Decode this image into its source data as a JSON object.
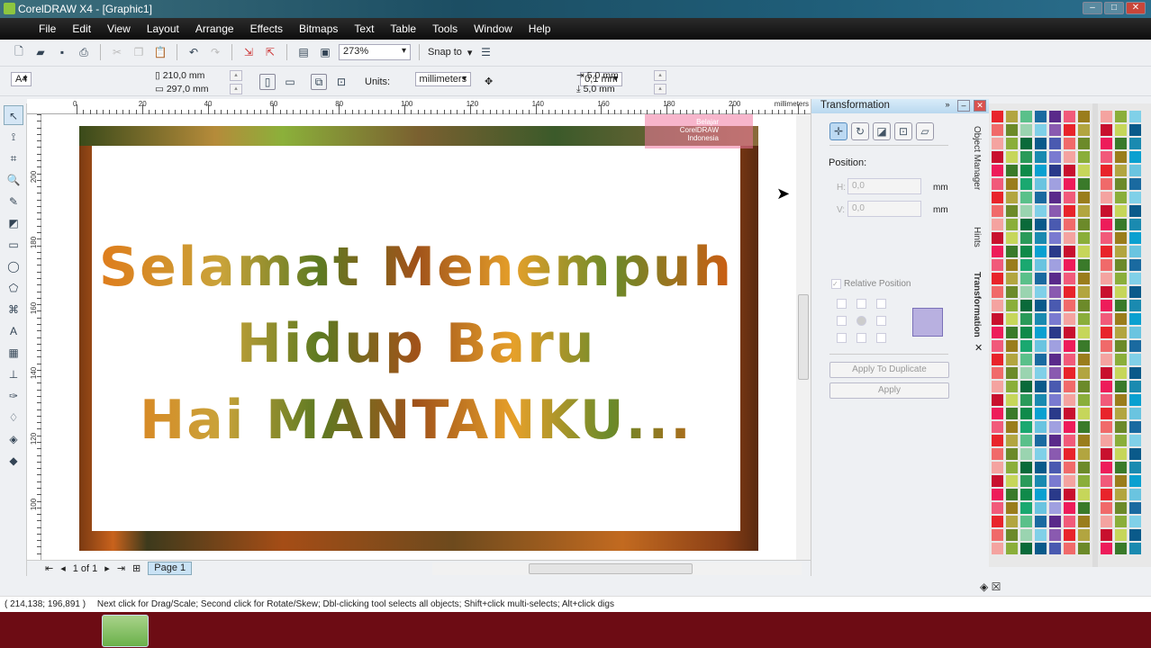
{
  "window": {
    "title": "CorelDRAW X4 - [Graphic1]",
    "app_icon": "coreldraw-icon"
  },
  "menu": [
    "File",
    "Edit",
    "View",
    "Layout",
    "Arrange",
    "Effects",
    "Bitmaps",
    "Text",
    "Table",
    "Tools",
    "Window",
    "Help"
  ],
  "toolbar": {
    "zoom": "273%",
    "snap_to": "Snap to"
  },
  "property_bar": {
    "page_size": "A4",
    "width": "210,0 mm",
    "height": "297,0 mm",
    "units_label": "Units:",
    "units": "millimeters",
    "nudge": "0,1 mm",
    "dup_x": "5,0 mm",
    "dup_y": "5,0 mm"
  },
  "ruler": {
    "unit": "millimeters",
    "h_labels": [
      "0",
      "20",
      "40",
      "60",
      "80",
      "100",
      "120",
      "140",
      "160",
      "180",
      "200"
    ],
    "v_labels": [
      "200",
      "180",
      "160",
      "140",
      "120",
      "100"
    ]
  },
  "document": {
    "lines": [
      "Selamat  Menempuh",
      "Hidup  Baru",
      "Hai  MANTANKU..."
    ],
    "watermark": [
      "Belajar",
      "CorelDRAW",
      "Indonesia"
    ]
  },
  "page_nav": {
    "count": "1 of 1",
    "page_tab": "Page 1"
  },
  "docker": {
    "title": "Transformation",
    "position_label": "Position:",
    "h_label": "H:",
    "h_value": "0,0",
    "v_label": "V:",
    "v_value": "0,0",
    "unit": "mm",
    "relative_position": "Relative Position",
    "apply_dup": "Apply To Duplicate",
    "apply": "Apply",
    "side_tabs": [
      "Object Manager",
      "Hints",
      "Transformation"
    ]
  },
  "status": {
    "coords": "( 214,138; 196,891 )",
    "hint": "Next click for Drag/Scale; Second click for Rotate/Skew; Dbl-clicking tool selects all objects; Shift+click multi-selects; Alt+click digs"
  }
}
